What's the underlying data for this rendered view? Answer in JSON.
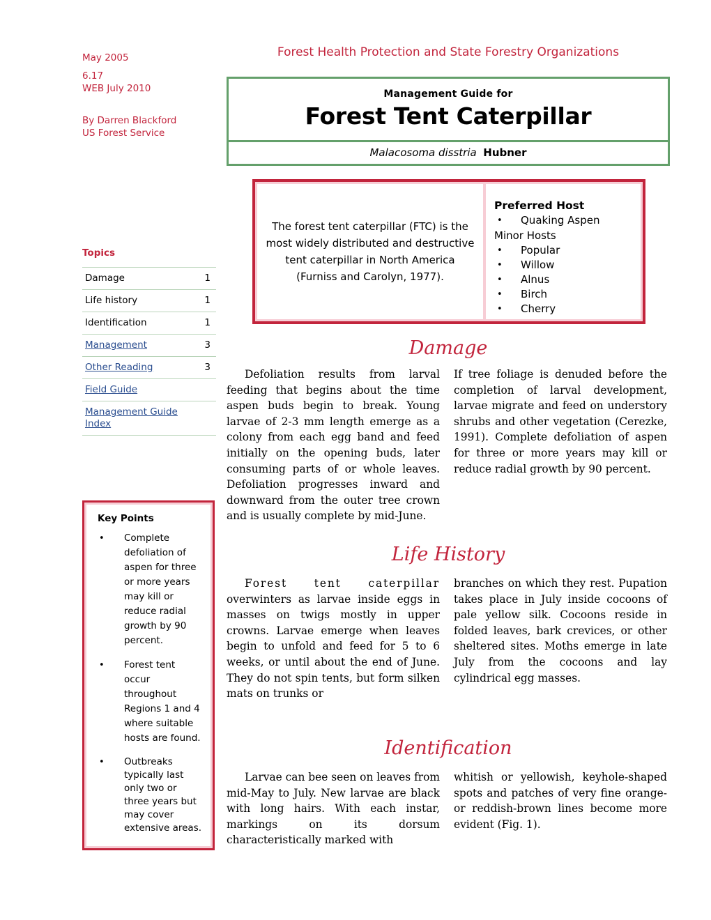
{
  "meta": {
    "date": "May 2005",
    "doc_number": "6.17",
    "web_date": "WEB July 2010",
    "author": "By Darren Blackford",
    "agency": "US Forest Service"
  },
  "header": {
    "organization": "Forest Health Protection and State Forestry Organizations",
    "kicker": "Management Guide for",
    "title": "Forest Tent Caterpillar",
    "scientific_name": "Malacosoma disstria",
    "authority": "Hubner"
  },
  "topics": {
    "title": "Topics",
    "rows": [
      {
        "label": "Damage",
        "page": "1",
        "link": false
      },
      {
        "label": "Life history",
        "page": "1",
        "link": false
      },
      {
        "label": "Identification",
        "page": "1",
        "link": false
      },
      {
        "label": "Management",
        "page": "3",
        "link": true
      },
      {
        "label": "Other Reading",
        "page": "3",
        "link": true
      },
      {
        "label": "Field Guide",
        "page": "",
        "link": true
      },
      {
        "label": "Management Guide Index",
        "page": "",
        "link": true
      }
    ]
  },
  "info_box": {
    "summary": "The forest tent caterpillar (FTC) is the most widely distributed and destructive tent caterpillar in North America (Furniss and Carolyn, 1977).",
    "preferred_host_heading": "Preferred Host",
    "preferred_hosts": [
      "Quaking Aspen"
    ],
    "minor_hosts_heading": "Minor Hosts",
    "minor_hosts": [
      "Popular",
      "Willow",
      "Alnus",
      "Birch",
      "Cherry"
    ]
  },
  "key_points": {
    "title": "Key Points",
    "items": [
      "Complete defoliation of aspen for three or more years may kill or reduce radial growth by 90 percent.",
      "Forest tent occur throughout Regions 1 and 4 where suitable hosts are found.",
      "Outbreaks typically last only two or three years but may cover extensive areas."
    ]
  },
  "sections": {
    "damage": {
      "heading": "Damage",
      "col1": "Defoliation results from larval feeding that begins about the time aspen buds begin to break. Young larvae of 2-3 mm length emerge as a colony from each egg band and feed initially on the opening buds, later consuming parts of or whole leaves. Defoliation progresses inward and downward from the outer tree crown and is usually complete by mid-June.",
      "col2": "If tree foliage is denuded before the completion of larval development, larvae migrate and feed on understory shrubs and other vegetation (Cerezke, 1991). Complete defoliation of aspen for three or more years may kill or reduce radial growth by 90 percent."
    },
    "life_history": {
      "heading": "Life History",
      "col1_lead": "Forest tent caterpillar",
      "col1": " overwinters as larvae inside eggs in masses on twigs mostly in upper crowns. Larvae emerge when leaves begin to unfold and feed for 5 to 6 weeks, or until about the end of June. They do not spin tents, but form silken mats on trunks or",
      "col2": "branches on which they rest. Pupation takes place in July inside cocoons of pale yellow silk. Cocoons reside in folded leaves, bark crevices, or other sheltered sites. Moths emerge in late July from the cocoons and lay cylindrical egg masses."
    },
    "identification": {
      "heading": "Identification",
      "col1": "Larvae can bee seen on leaves from mid-May to July. New larvae are black with long hairs. With each instar, markings on its dorsum characteristically marked with",
      "col2": "whitish or yellowish, keyhole-shaped spots and patches of very fine orange-or reddish-brown lines become more evident (Fig. 1)."
    }
  },
  "colors": {
    "accent_red": "#c2243c",
    "border_green": "#64a06b",
    "link_blue": "#2a4d8f",
    "rule_green": "#b9d4b9",
    "pink_inner": "#f7cdd5"
  },
  "glyphs": {
    "bullet": "•"
  }
}
